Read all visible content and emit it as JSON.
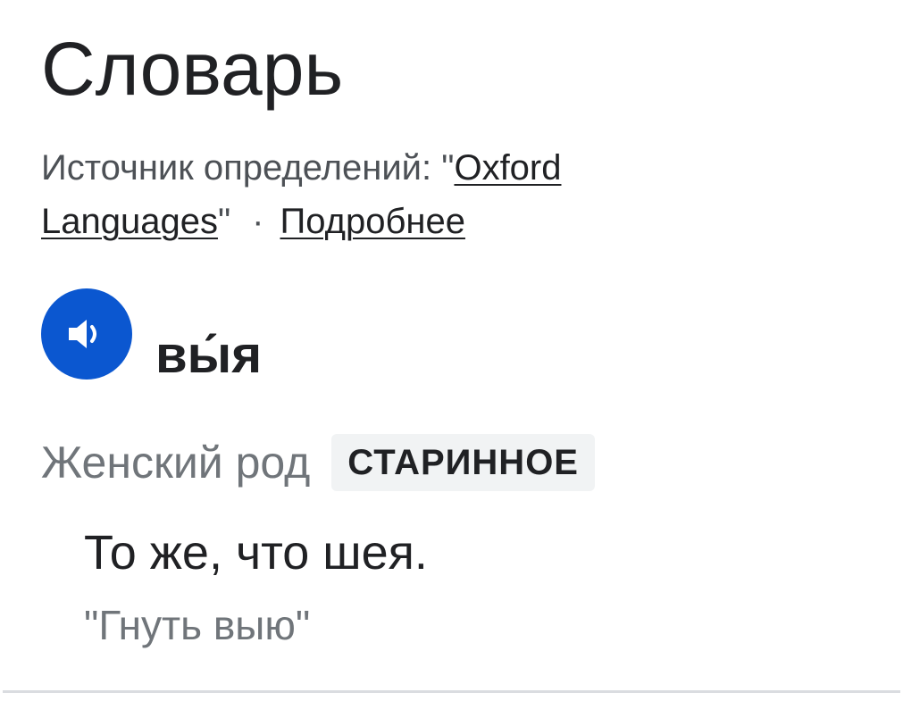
{
  "section": {
    "title": "Словарь"
  },
  "source": {
    "prefix": "Источник определений: \"",
    "link_label": "Oxford Languages",
    "suffix": "\"",
    "separator": "·",
    "more_label": "Подробнее"
  },
  "entry": {
    "speaker_icon": "speaker-icon",
    "word": "вы́я",
    "part_of_speech": "Женский род",
    "badge": "СТАРИННОЕ",
    "definition": "То же, что шея.",
    "example": "\"Гнуть выю\""
  },
  "colors": {
    "speaker_button": "#0b57d0",
    "badge_background": "#f1f3f4"
  }
}
